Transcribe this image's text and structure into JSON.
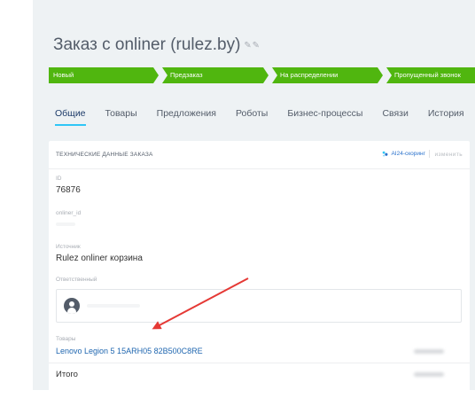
{
  "header": {
    "title": "Заказ с onliner  (rulez.by)"
  },
  "stages": [
    {
      "label": "Новый"
    },
    {
      "label": "Предзаказ"
    },
    {
      "label": "На распределении"
    },
    {
      "label": "Пропущенный звонок"
    }
  ],
  "colors": {
    "stage_green": "#50b60f",
    "tab_underline": "#2fc6f6",
    "link_blue": "#2067b0",
    "arrow_red": "#e53935"
  },
  "tabs": [
    {
      "label": "Общие",
      "active": true
    },
    {
      "label": "Товары"
    },
    {
      "label": "Предложения"
    },
    {
      "label": "Роботы"
    },
    {
      "label": "Бизнес-процессы"
    },
    {
      "label": "Связи"
    },
    {
      "label": "История"
    }
  ],
  "card": {
    "title": "ТЕХНИЧЕСКИЕ ДАННЫЕ ЗАКАЗА",
    "ai_label": "AI24-скоринг",
    "edit_label": "изменить",
    "fields": {
      "id": {
        "label": "ID",
        "value": "76876"
      },
      "onliner_id": {
        "label": "onliner_id"
      },
      "source": {
        "label": "Источник",
        "value": "Rulez onliner корзина"
      },
      "responsible": {
        "label": "Ответственный"
      }
    },
    "products": {
      "label": "Товары",
      "item": "Lenovo Legion 5 15ARH05 82B500C8RE"
    },
    "total_label": "Итого"
  },
  "icons": {
    "edit": "pencil-icon",
    "ai": "ai-sparkle-icon",
    "avatar": "user-avatar-icon",
    "annotation": "red-arrow-annotation"
  }
}
